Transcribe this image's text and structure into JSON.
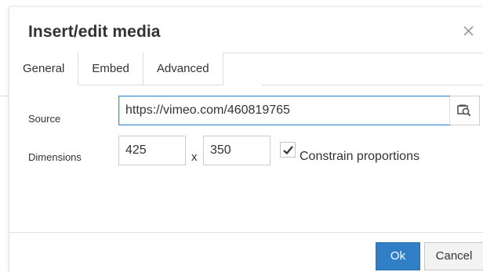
{
  "dialog": {
    "title": "Insert/edit media"
  },
  "tabs": [
    {
      "label": "General",
      "active": true
    },
    {
      "label": "Embed",
      "active": false
    },
    {
      "label": "Advanced",
      "active": false
    }
  ],
  "form": {
    "source_label": "Source",
    "source_value": "https://vimeo.com/460819765",
    "dimensions_label": "Dimensions",
    "width_value": "425",
    "times_symbol": "x",
    "height_value": "350",
    "constrain_label": "Constrain proportions",
    "constrain_checked": true
  },
  "buttons": {
    "ok_label": "Ok",
    "cancel_label": "Cancel"
  },
  "icons": {
    "close": "close-icon",
    "browse": "browse-icon",
    "check": "checkmark-icon"
  },
  "colors": {
    "primary": "#2f7ec6",
    "focus_border": "#3d8ed4",
    "text": "#333333"
  }
}
